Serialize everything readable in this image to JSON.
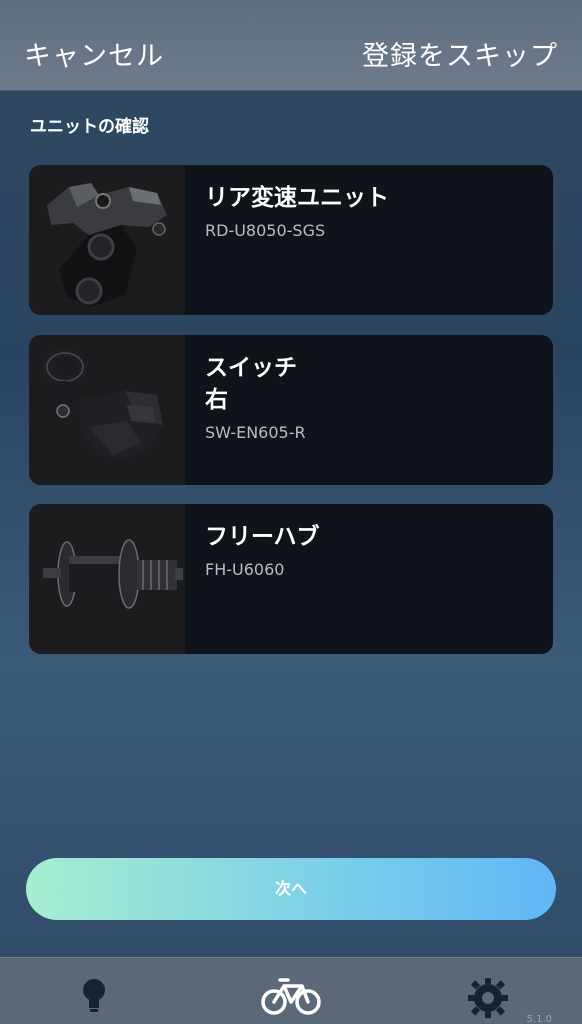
{
  "header": {
    "cancel_label": "キャンセル",
    "skip_label": "登録をスキップ"
  },
  "section_title": "ユニットの確認",
  "units": [
    {
      "name": "リア変速ユニット",
      "model": "RD-U8050-SGS",
      "image_icon": "rear-derailleur-image"
    },
    {
      "name": "スイッチ\n右",
      "model": "SW-EN605-R",
      "image_icon": "shift-switch-image"
    },
    {
      "name": "フリーハブ",
      "model": "FH-U6060",
      "image_icon": "freehub-image"
    }
  ],
  "next_button_label": "次へ",
  "tabbar": {
    "tabs": [
      {
        "icon": "lightbulb-icon"
      },
      {
        "icon": "bicycle-icon"
      },
      {
        "icon": "gear-icon"
      }
    ],
    "version": "5.1.0"
  },
  "colors": {
    "card_bg": "#0f141b",
    "button_gradient_start": "#a6eed0",
    "button_gradient_end": "#5fb7f5"
  }
}
